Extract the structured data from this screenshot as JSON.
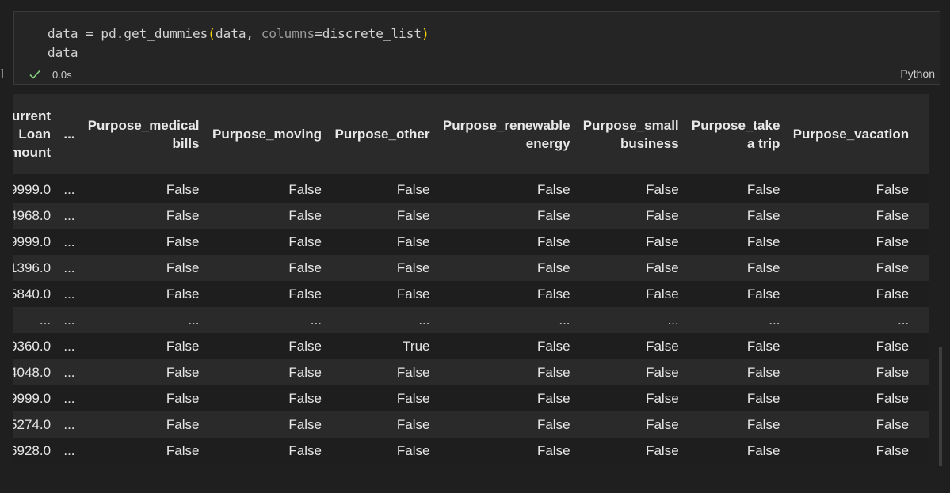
{
  "cell": {
    "code_line1_tokens": {
      "a": "data",
      "b": " = pd.get_dummies",
      "c": "(",
      "d": "data, ",
      "e": "columns",
      "f": "=discrete_list",
      "g": ")"
    },
    "code_line2": "data",
    "exec_time": "0.0s",
    "language": "Python",
    "exec_marker": "]"
  },
  "table": {
    "headers": [
      "urrent Loan mount",
      "...",
      "Purpose_medical bills",
      "Purpose_moving",
      "Purpose_other",
      "Purpose_renewable energy",
      "Purpose_small business",
      "Purpose_take a trip",
      "Purpose_vacation"
    ],
    "rows": [
      [
        "9999.0",
        "...",
        "False",
        "False",
        "False",
        "False",
        "False",
        "False",
        "False"
      ],
      [
        "4968.0",
        "...",
        "False",
        "False",
        "False",
        "False",
        "False",
        "False",
        "False"
      ],
      [
        "9999.0",
        "...",
        "False",
        "False",
        "False",
        "False",
        "False",
        "False",
        "False"
      ],
      [
        "1396.0",
        "...",
        "False",
        "False",
        "False",
        "False",
        "False",
        "False",
        "False"
      ],
      [
        "5840.0",
        "...",
        "False",
        "False",
        "False",
        "False",
        "False",
        "False",
        "False"
      ],
      [
        "...",
        "...",
        "...",
        "...",
        "...",
        "...",
        "...",
        "...",
        "..."
      ],
      [
        "9360.0",
        "...",
        "False",
        "False",
        "True",
        "False",
        "False",
        "False",
        "False"
      ],
      [
        "4048.0",
        "...",
        "False",
        "False",
        "False",
        "False",
        "False",
        "False",
        "False"
      ],
      [
        "9999.0",
        "...",
        "False",
        "False",
        "False",
        "False",
        "False",
        "False",
        "False"
      ],
      [
        "5274.0",
        "...",
        "False",
        "False",
        "False",
        "False",
        "False",
        "False",
        "False"
      ],
      [
        "6928.0",
        "...",
        "False",
        "False",
        "False",
        "False",
        "False",
        "False",
        "False"
      ]
    ]
  },
  "colors": {
    "background": "#1f1f1f",
    "cell_background": "#252526",
    "success_check": "#89d185",
    "paren": "#ffd700"
  },
  "icons": {
    "success": "check-icon"
  }
}
